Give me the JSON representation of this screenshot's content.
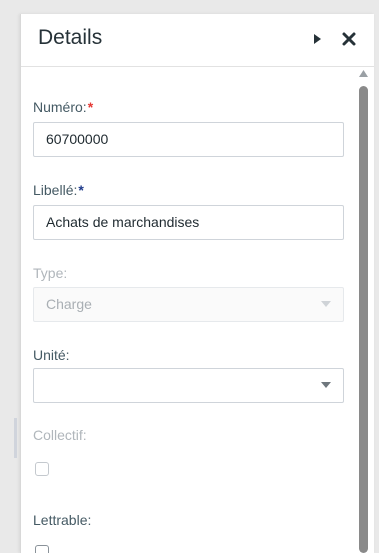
{
  "panel": {
    "title": "Details",
    "collapse_icon": "caret-right-icon",
    "close_icon": "close-icon"
  },
  "form": {
    "numero": {
      "label": "Numéro:",
      "required": "*",
      "value": "60700000"
    },
    "libelle": {
      "label": "Libellé:",
      "required": "*",
      "value": "Achats de marchandises"
    },
    "type": {
      "label": "Type:",
      "value": "Charge",
      "disabled": true
    },
    "unite": {
      "label": "Unité:",
      "value": ""
    },
    "collectif": {
      "label": "Collectif:",
      "checked": false,
      "disabled": true
    },
    "lettrable": {
      "label": "Lettrable:",
      "checked": false
    }
  },
  "colors": {
    "required_red": "#e53935",
    "required_blue": "#1e3a8a",
    "scroll_thumb": "#8a8a8a"
  }
}
